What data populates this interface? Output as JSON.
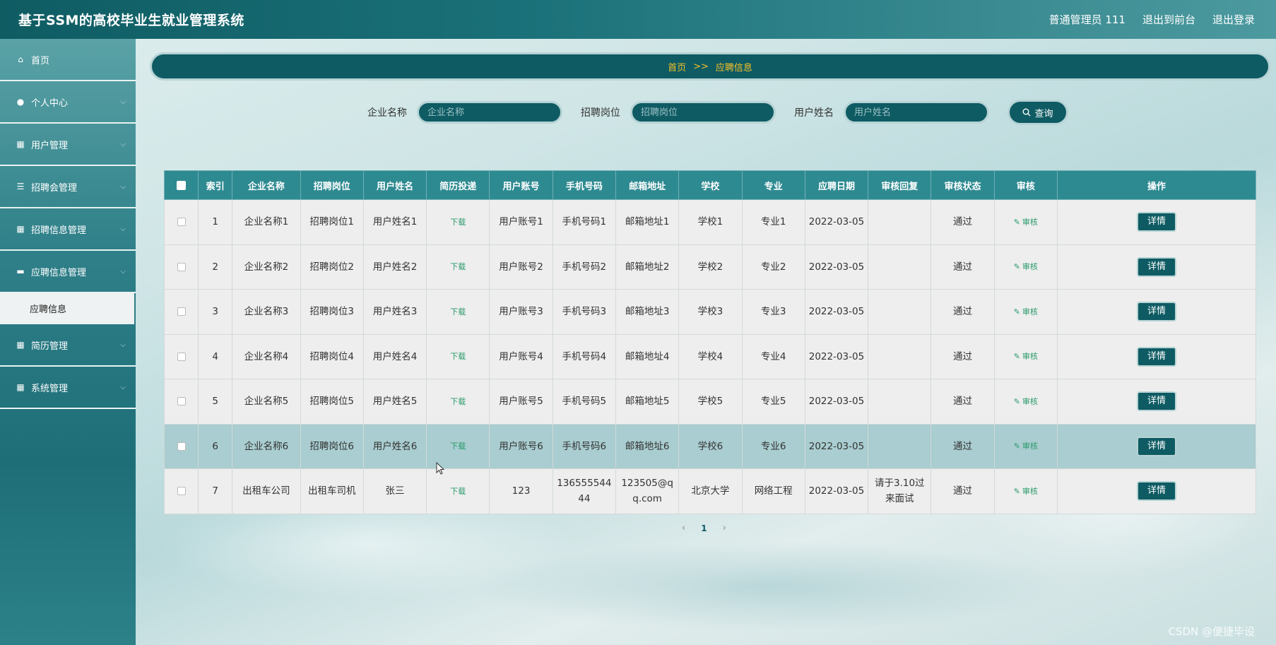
{
  "header": {
    "title": "基于SSM的高校毕业生就业管理系统",
    "user_label": "普通管理员 111",
    "to_front_label": "退出到前台",
    "logout_label": "退出登录"
  },
  "sidebar": {
    "items": [
      {
        "label": "首页",
        "icon": "home-icon"
      },
      {
        "label": "个人中心",
        "icon": "user-icon"
      },
      {
        "label": "用户管理",
        "icon": "grid-icon"
      },
      {
        "label": "招聘会管理",
        "icon": "list-icon"
      },
      {
        "label": "招聘信息管理",
        "icon": "grid-icon"
      },
      {
        "label": "应聘信息管理",
        "icon": "monitor-icon"
      },
      {
        "label": "简历管理",
        "icon": "grid-icon"
      },
      {
        "label": "系统管理",
        "icon": "grid-icon"
      }
    ],
    "subitem": "应聘信息"
  },
  "breadcrumb": {
    "home": "首页",
    "separator": ">>",
    "current": "应聘信息"
  },
  "search": {
    "company_label": "企业名称",
    "company_placeholder": "企业名称",
    "position_label": "招聘岗位",
    "position_placeholder": "招聘岗位",
    "username_label": "用户姓名",
    "username_placeholder": "用户姓名",
    "button_label": "查询"
  },
  "table": {
    "headers": [
      "索引",
      "企业名称",
      "招聘岗位",
      "用户姓名",
      "简历投递",
      "用户账号",
      "手机号码",
      "邮箱地址",
      "学校",
      "专业",
      "应聘日期",
      "审核回复",
      "审核状态",
      "审核",
      "操作"
    ],
    "download_label": "下载",
    "audit_label": "审核",
    "detail_label": "详情",
    "rows": [
      {
        "idx": "1",
        "company": "企业名称1",
        "position": "招聘岗位1",
        "name": "用户姓名1",
        "account": "用户账号1",
        "phone": "手机号码1",
        "email": "邮箱地址1",
        "school": "学校1",
        "major": "专业1",
        "date": "2022-03-05",
        "reply": "",
        "status": "通过"
      },
      {
        "idx": "2",
        "company": "企业名称2",
        "position": "招聘岗位2",
        "name": "用户姓名2",
        "account": "用户账号2",
        "phone": "手机号码2",
        "email": "邮箱地址2",
        "school": "学校2",
        "major": "专业2",
        "date": "2022-03-05",
        "reply": "",
        "status": "通过"
      },
      {
        "idx": "3",
        "company": "企业名称3",
        "position": "招聘岗位3",
        "name": "用户姓名3",
        "account": "用户账号3",
        "phone": "手机号码3",
        "email": "邮箱地址3",
        "school": "学校3",
        "major": "专业3",
        "date": "2022-03-05",
        "reply": "",
        "status": "通过"
      },
      {
        "idx": "4",
        "company": "企业名称4",
        "position": "招聘岗位4",
        "name": "用户姓名4",
        "account": "用户账号4",
        "phone": "手机号码4",
        "email": "邮箱地址4",
        "school": "学校4",
        "major": "专业4",
        "date": "2022-03-05",
        "reply": "",
        "status": "通过"
      },
      {
        "idx": "5",
        "company": "企业名称5",
        "position": "招聘岗位5",
        "name": "用户姓名5",
        "account": "用户账号5",
        "phone": "手机号码5",
        "email": "邮箱地址5",
        "school": "学校5",
        "major": "专业5",
        "date": "2022-03-05",
        "reply": "",
        "status": "通过"
      },
      {
        "idx": "6",
        "company": "企业名称6",
        "position": "招聘岗位6",
        "name": "用户姓名6",
        "account": "用户账号6",
        "phone": "手机号码6",
        "email": "邮箱地址6",
        "school": "学校6",
        "major": "专业6",
        "date": "2022-03-05",
        "reply": "",
        "status": "通过"
      },
      {
        "idx": "7",
        "company": "出租车公司",
        "position": "出租车司机",
        "name": "张三",
        "account": "123",
        "phone": "13655554444",
        "email": "123505@qq.com",
        "school": "北京大学",
        "major": "网络工程",
        "date": "2022-03-05",
        "reply": "请于3.10过来面试",
        "status": "通过"
      }
    ],
    "highlighted_row": 6
  },
  "pagination": {
    "prev": "‹",
    "current_page": "1",
    "next": "›"
  },
  "watermark": "CSDN @便捷毕设"
}
